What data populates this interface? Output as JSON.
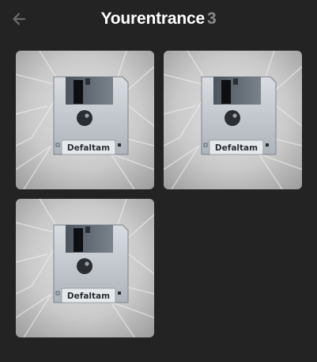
{
  "header": {
    "title": "Yourentrance",
    "count": "3"
  },
  "items": [
    {
      "label": "Defaltam"
    },
    {
      "label": "Defaltam"
    },
    {
      "label": "Defaltam"
    }
  ],
  "icons": {
    "back": "arrow-left-icon",
    "item": "floppy-disk-icon"
  },
  "colors": {
    "background": "#232323",
    "title": "#ffffff",
    "count": "#8a8a8a",
    "back_arrow": "#6b6b6b"
  }
}
